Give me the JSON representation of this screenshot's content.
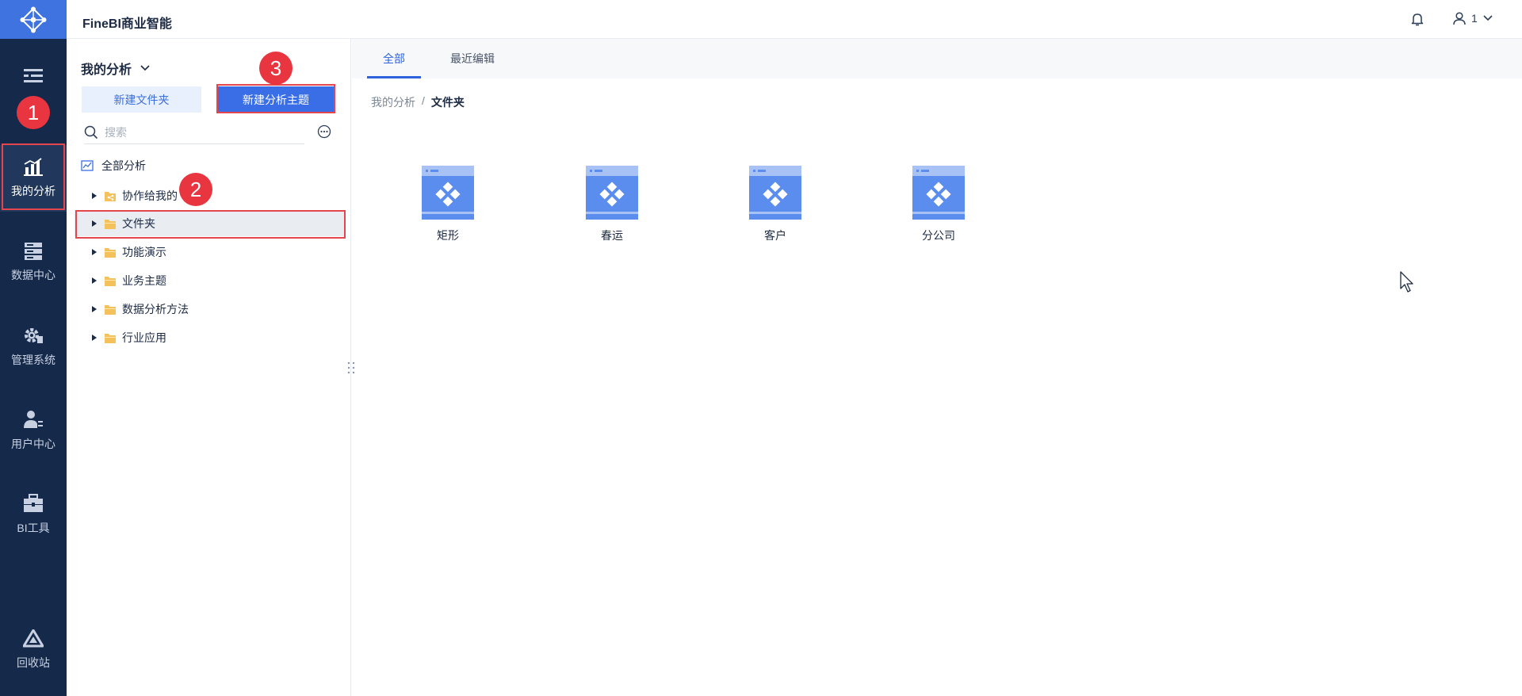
{
  "app": {
    "title": "FineBI商业智能"
  },
  "rail": {
    "items": [
      {
        "id": "directory",
        "label": ""
      },
      {
        "id": "my-analysis",
        "label": "我的分析"
      },
      {
        "id": "data-center",
        "label": "数据中心"
      },
      {
        "id": "admin-system",
        "label": "管理系统"
      },
      {
        "id": "user-center",
        "label": "用户中心"
      },
      {
        "id": "bi-tools",
        "label": "BI工具"
      },
      {
        "id": "recycle-bin",
        "label": "回收站"
      }
    ]
  },
  "header": {
    "user_label": "1"
  },
  "panel": {
    "title": "我的分析",
    "new_folder_label": "新建文件夹",
    "new_subject_label": "新建分析主题",
    "search_placeholder": "搜索",
    "tree_root": "全部分析",
    "tree": [
      {
        "label": "协作给我的",
        "type": "shared"
      },
      {
        "label": "文件夹",
        "type": "folder",
        "selected": true
      },
      {
        "label": "功能演示",
        "type": "folder"
      },
      {
        "label": "业务主题",
        "type": "folder"
      },
      {
        "label": "数据分析方法",
        "type": "folder"
      },
      {
        "label": "行业应用",
        "type": "folder"
      }
    ]
  },
  "tabs": [
    {
      "label": "全部",
      "active": true
    },
    {
      "label": "最近编辑",
      "active": false
    }
  ],
  "breadcrumb": {
    "root": "我的分析",
    "sep": "/",
    "current": "文件夹"
  },
  "items": [
    {
      "label": "矩形"
    },
    {
      "label": "春运"
    },
    {
      "label": "客户"
    },
    {
      "label": "分公司"
    }
  ],
  "annotations": [
    "1",
    "2",
    "3"
  ],
  "colors": {
    "rail_bg": "#15294b",
    "accent": "#3a6ee6",
    "highlight": "#e5464e",
    "badge": "#e8353f",
    "folder": "#f5c15b"
  }
}
